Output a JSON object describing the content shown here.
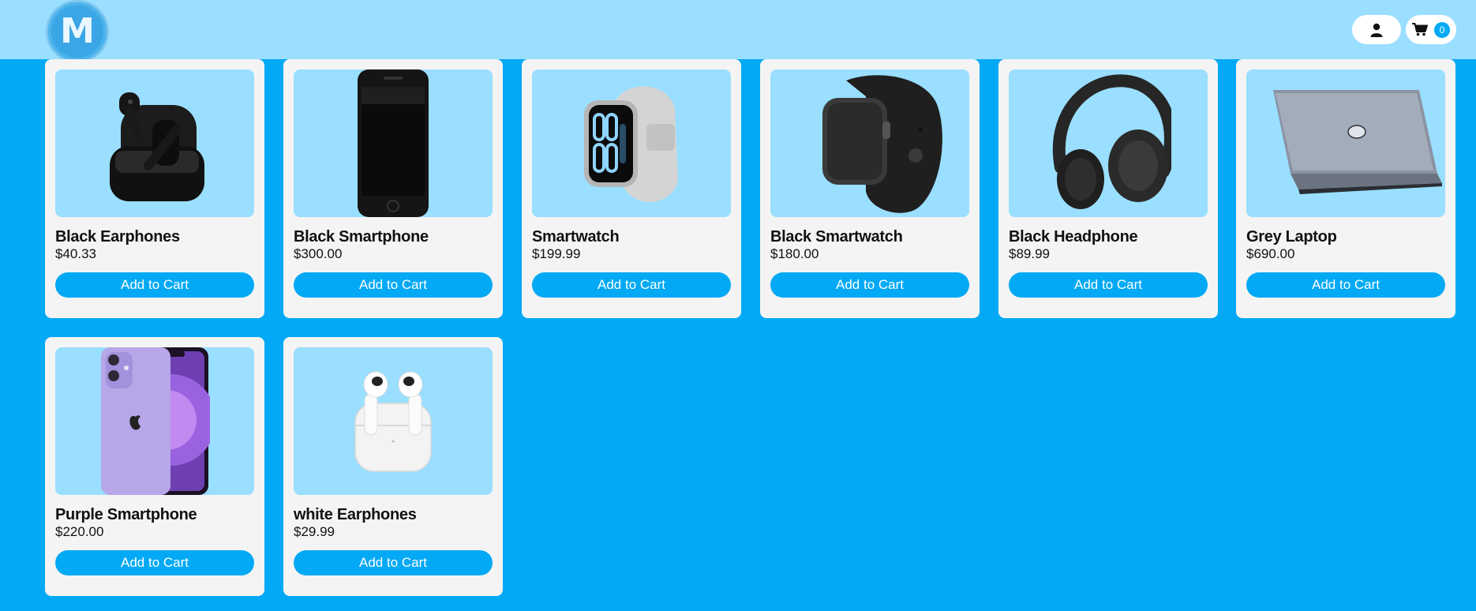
{
  "header": {
    "logo_letter": "M",
    "cart_count": "0",
    "icons": {
      "user": "user-icon",
      "cart": "cart-icon"
    }
  },
  "colors": {
    "page_bg": "#03a9f4",
    "header_bg": "#9adfff",
    "card_bg": "#f4f4f4",
    "image_bg": "#9adfff",
    "button_bg": "#03a9f4"
  },
  "products": [
    {
      "name": "Black Earphones",
      "price": "$40.33",
      "button": "Add to Cart",
      "image": "black-earphones-image"
    },
    {
      "name": "Black Smartphone",
      "price": "$300.00",
      "button": "Add to Cart",
      "image": "black-smartphone-image"
    },
    {
      "name": "Smartwatch",
      "price": "$199.99",
      "button": "Add to Cart",
      "image": "smartwatch-image"
    },
    {
      "name": "Black Smartwatch",
      "price": "$180.00",
      "button": "Add to Cart",
      "image": "black-smartwatch-image"
    },
    {
      "name": "Black Headphone",
      "price": "$89.99",
      "button": "Add to Cart",
      "image": "black-headphone-image"
    },
    {
      "name": "Grey Laptop",
      "price": "$690.00",
      "button": "Add to Cart",
      "image": "grey-laptop-image"
    },
    {
      "name": "Purple Smartphone",
      "price": "$220.00",
      "button": "Add to Cart",
      "image": "purple-smartphone-image"
    },
    {
      "name": "white Earphones",
      "price": "$29.99",
      "button": "Add to Cart",
      "image": "white-earphones-image"
    }
  ]
}
